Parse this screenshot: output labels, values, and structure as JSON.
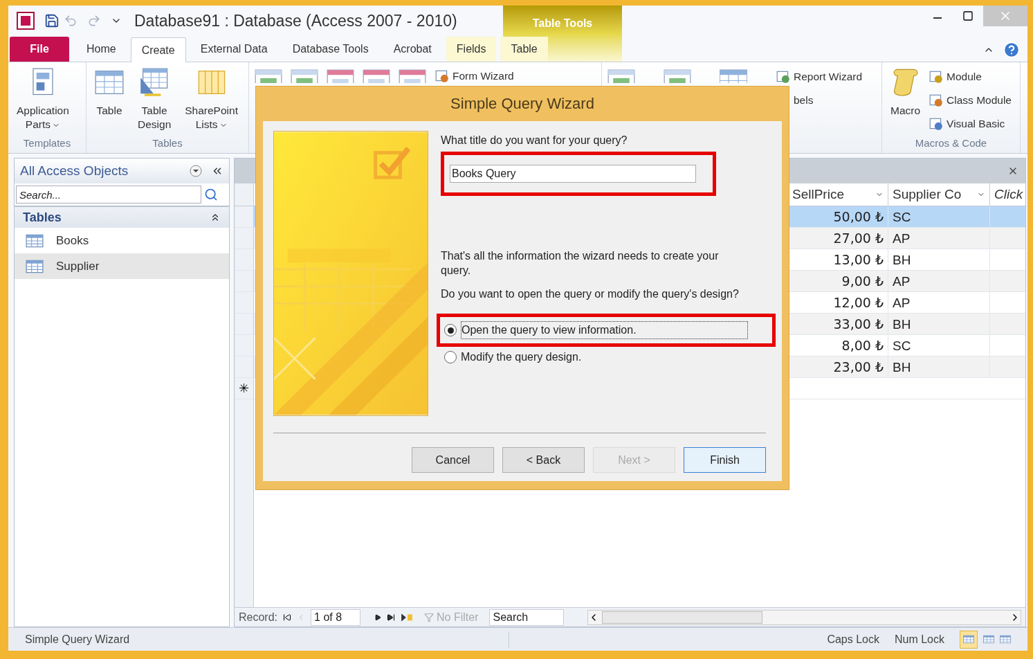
{
  "window": {
    "title": "Database91 : Database (Access 2007 - 2010)",
    "context_group": "Table Tools"
  },
  "ribbon_tabs": [
    {
      "label": "File",
      "kind": "file",
      "selected": false
    },
    {
      "label": "Home",
      "kind": "normal",
      "selected": false
    },
    {
      "label": "Create",
      "kind": "normal",
      "selected": true
    },
    {
      "label": "External Data",
      "kind": "normal",
      "selected": false
    },
    {
      "label": "Database Tools",
      "kind": "normal",
      "selected": false
    },
    {
      "label": "Acrobat",
      "kind": "normal",
      "selected": false
    },
    {
      "label": "Fields",
      "kind": "context",
      "selected": false
    },
    {
      "label": "Table",
      "kind": "context",
      "selected": false
    }
  ],
  "ribbon_groups": [
    {
      "label": "Templates",
      "items": [
        {
          "kind": "large",
          "lines": [
            "Application",
            "Parts"
          ],
          "dropdown": true
        }
      ]
    },
    {
      "label": "Tables",
      "items": [
        {
          "kind": "large",
          "lines": [
            "Table"
          ],
          "dropdown": false
        },
        {
          "kind": "large",
          "lines": [
            "Table",
            "Design"
          ],
          "dropdown": false
        },
        {
          "kind": "large",
          "lines": [
            "SharePoint",
            "Lists"
          ],
          "dropdown": true
        }
      ]
    },
    {
      "items": [
        {
          "kind": "icon"
        },
        {
          "kind": "icon"
        },
        {
          "kind": "icon"
        },
        {
          "kind": "icon"
        },
        {
          "kind": "icon"
        },
        {
          "kind": "small",
          "label": "Form Wizard"
        }
      ]
    },
    {
      "items": [
        {
          "kind": "icon"
        },
        {
          "kind": "icon"
        },
        {
          "kind": "icon"
        },
        {
          "kind": "stack",
          "rows": [
            "Report Wizard",
            "bels"
          ]
        }
      ]
    },
    {
      "label": "Macros & Code",
      "items": [
        {
          "kind": "large",
          "lines": [
            "Macro"
          ],
          "dropdown": false
        },
        {
          "kind": "stack",
          "rows": [
            "Module",
            "Class Module",
            "Visual Basic"
          ]
        }
      ]
    }
  ],
  "nav_pane": {
    "title": "All Access Objects",
    "search": {
      "placeholder": "Search..."
    },
    "section": "Tables",
    "items": [
      {
        "label": "Books",
        "selected": false
      },
      {
        "label": "Supplier",
        "selected": true
      }
    ]
  },
  "datasheet": {
    "columns": [
      {
        "label": "SellPrice",
        "dropdown": true
      },
      {
        "label": "Supplier Co",
        "dropdown": true
      },
      {
        "label": "Click",
        "dropdown": false
      }
    ],
    "rows": [
      {
        "cells": [
          "50,00 ₺",
          "SC"
        ],
        "selected": true
      },
      {
        "cells": [
          "27,00 ₺",
          "AP"
        ],
        "selected": false
      },
      {
        "cells": [
          "13,00 ₺",
          "BH"
        ],
        "selected": false
      },
      {
        "cells": [
          "9,00 ₺",
          "AP"
        ],
        "selected": false
      },
      {
        "cells": [
          "12,00 ₺",
          "AP"
        ],
        "selected": false
      },
      {
        "cells": [
          "33,00 ₺",
          "BH"
        ],
        "selected": false
      },
      {
        "cells": [
          "8,00 ₺",
          "SC"
        ],
        "selected": false
      },
      {
        "cells": [
          "23,00 ₺",
          "BH"
        ],
        "selected": false
      }
    ],
    "new_row_marker": "✳"
  },
  "record_nav": {
    "label": "Record:",
    "position": "1 of 8",
    "filter": {
      "label": "No Filter",
      "disabled": true
    },
    "search": "Search"
  },
  "status_bar": {
    "text": "Simple Query Wizard",
    "indicators": [
      "Caps Lock",
      "Num Lock"
    ]
  },
  "dialog": {
    "title": "Simple Query Wizard",
    "prompt": "What title do you want for your query?",
    "title_field": {
      "value": "Books Query",
      "highlighted": true
    },
    "info": "That's all the information the wizard needs to create your query.",
    "question": "Do you want to open the query or modify the query's design?",
    "options": [
      {
        "label": "Open the query to view information.",
        "selected": true,
        "highlighted": true
      },
      {
        "label": "Modify the query design.",
        "selected": false,
        "highlighted": false
      }
    ],
    "buttons": [
      {
        "label": "Cancel",
        "disabled": false,
        "default": false
      },
      {
        "label": "< Back",
        "disabled": false,
        "default": false
      },
      {
        "label": "Next >",
        "disabled": true,
        "default": false
      },
      {
        "label": "Finish",
        "disabled": false,
        "default": true
      }
    ]
  }
}
